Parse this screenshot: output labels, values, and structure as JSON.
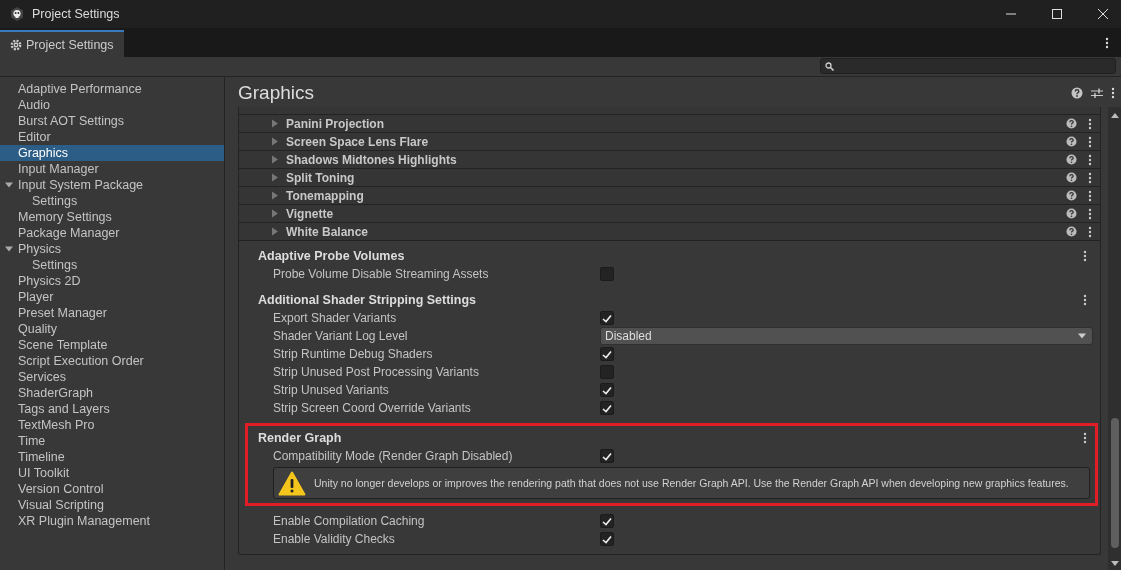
{
  "window": {
    "title": "Project Settings"
  },
  "tab": {
    "label": "Project Settings",
    "selected": true
  },
  "sidebar": {
    "items": [
      {
        "label": "Adaptive Performance",
        "selected": false
      },
      {
        "label": "Audio",
        "selected": false
      },
      {
        "label": "Burst AOT Settings",
        "selected": false
      },
      {
        "label": "Editor",
        "selected": false
      },
      {
        "label": "Graphics",
        "selected": true
      },
      {
        "label": "Input Manager",
        "selected": false
      },
      {
        "label": "Input System Package",
        "selected": false,
        "expanded": true,
        "children": [
          {
            "label": "Settings",
            "selected": false
          }
        ]
      },
      {
        "label": "Memory Settings",
        "selected": false
      },
      {
        "label": "Package Manager",
        "selected": false
      },
      {
        "label": "Physics",
        "selected": false,
        "expanded": true,
        "children": [
          {
            "label": "Settings",
            "selected": false
          }
        ]
      },
      {
        "label": "Physics 2D",
        "selected": false
      },
      {
        "label": "Player",
        "selected": false
      },
      {
        "label": "Preset Manager",
        "selected": false
      },
      {
        "label": "Quality",
        "selected": false
      },
      {
        "label": "Scene Template",
        "selected": false
      },
      {
        "label": "Script Execution Order",
        "selected": false
      },
      {
        "label": "Services",
        "selected": false
      },
      {
        "label": "ShaderGraph",
        "selected": false
      },
      {
        "label": "Tags and Layers",
        "selected": false
      },
      {
        "label": "TextMesh Pro",
        "selected": false
      },
      {
        "label": "Time",
        "selected": false
      },
      {
        "label": "Timeline",
        "selected": false
      },
      {
        "label": "UI Toolkit",
        "selected": false
      },
      {
        "label": "Version Control",
        "selected": false
      },
      {
        "label": "Visual Scripting",
        "selected": false
      },
      {
        "label": "XR Plugin Management",
        "selected": false
      }
    ]
  },
  "page": {
    "title": "Graphics"
  },
  "overrides": [
    {
      "label": "Panini Projection",
      "expanded": false
    },
    {
      "label": "Screen Space Lens Flare",
      "expanded": false
    },
    {
      "label": "Shadows Midtones Highlights",
      "expanded": false
    },
    {
      "label": "Split Toning",
      "expanded": false
    },
    {
      "label": "Tonemapping",
      "expanded": false
    },
    {
      "label": "Vignette",
      "expanded": false
    },
    {
      "label": "White Balance",
      "expanded": false
    }
  ],
  "sections": [
    {
      "title": "Adaptive Probe Volumes",
      "highlighted": false,
      "fields": [
        {
          "kind": "checkbox",
          "label": "Probe Volume Disable Streaming Assets",
          "checked": false
        }
      ]
    },
    {
      "title": "Additional Shader Stripping Settings",
      "highlighted": false,
      "fields": [
        {
          "kind": "checkbox",
          "label": "Export Shader Variants",
          "checked": true
        },
        {
          "kind": "dropdown",
          "label": "Shader Variant Log Level",
          "value": "Disabled"
        },
        {
          "kind": "checkbox",
          "label": "Strip Runtime Debug Shaders",
          "checked": true
        },
        {
          "kind": "checkbox",
          "label": "Strip Unused Post Processing Variants",
          "checked": false
        },
        {
          "kind": "checkbox",
          "label": "Strip Unused Variants",
          "checked": true
        },
        {
          "kind": "checkbox",
          "label": "Strip Screen Coord Override Variants",
          "checked": true
        }
      ]
    },
    {
      "title": "Render Graph",
      "highlighted": true,
      "fields": [
        {
          "kind": "checkbox",
          "label": "Compatibility Mode (Render Graph Disabled)",
          "checked": true
        },
        {
          "kind": "warning",
          "text": "Unity no longer develops or improves the rendering path that does not use Render Graph API. Use the Render Graph API when developing new graphics features."
        }
      ]
    },
    {
      "highlighted": false,
      "fields": [
        {
          "kind": "checkbox",
          "label": "Enable Compilation Caching",
          "checked": true
        },
        {
          "kind": "checkbox",
          "label": "Enable Validity Checks",
          "checked": true
        }
      ]
    }
  ]
}
